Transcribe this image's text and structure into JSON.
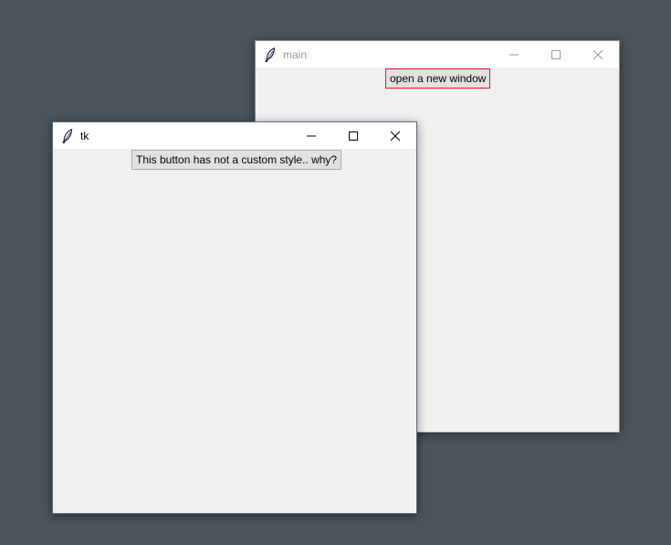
{
  "windows": {
    "main": {
      "title": "main",
      "button_label": "open a new window",
      "icon": "feather-icon",
      "inactive_title_color": "#999999"
    },
    "tk": {
      "title": "tk",
      "button_label": "This button has not a custom style.. why?",
      "icon": "feather-icon"
    }
  },
  "colors": {
    "desktop": "#4b545a",
    "window_bg": "#f0f0f0",
    "titlebar_bg": "#ffffff",
    "red_border": "#e81123"
  }
}
